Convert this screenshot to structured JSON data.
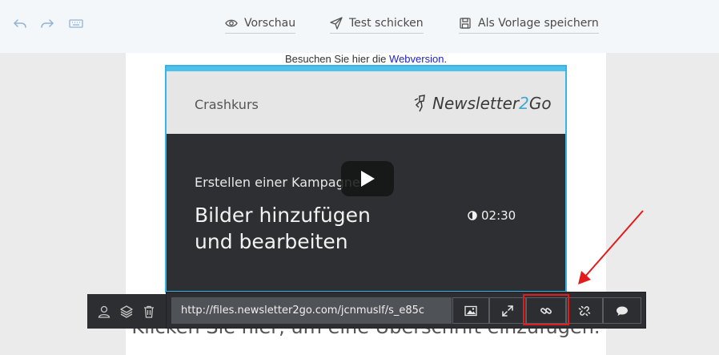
{
  "toolbar": {
    "undo_icon": "undo-icon",
    "redo_icon": "redo-icon",
    "keyboard_icon": "keyboard-icon",
    "preview_label": "Vorschau",
    "send_test_label": "Test schicken",
    "save_template_label": "Als Vorlage speichern"
  },
  "canvas": {
    "webversion_prefix": "Besuchen Sie hier die ",
    "webversion_link": "Webversion",
    "webversion_suffix": ".",
    "heading_placeholder": "Klicken Sie hier, um eine Überschrift einzufügen."
  },
  "video": {
    "header_left": "Crashkurs",
    "logo_prefix": "Newsletter",
    "logo_number": "2",
    "logo_suffix": "Go",
    "subtitle": "Erstellen einer Kampagne",
    "title_line1": "Bilder hinzufügen",
    "title_line2": "und bearbeiten",
    "duration": "02:30"
  },
  "image_toolbar": {
    "url_value": "http://files.newsletter2go.com/jcnmuslf/s_e85c",
    "buttons": [
      "image-icon",
      "expand-icon",
      "link-icon",
      "unlink-icon",
      "comment-icon"
    ]
  },
  "left_tools": [
    "user-icon",
    "layers-icon",
    "trash-icon"
  ],
  "colors": {
    "accent_blue": "#35b4e6",
    "highlight_red": "#e41b1b",
    "toolbar_dark": "#2c2e31"
  }
}
